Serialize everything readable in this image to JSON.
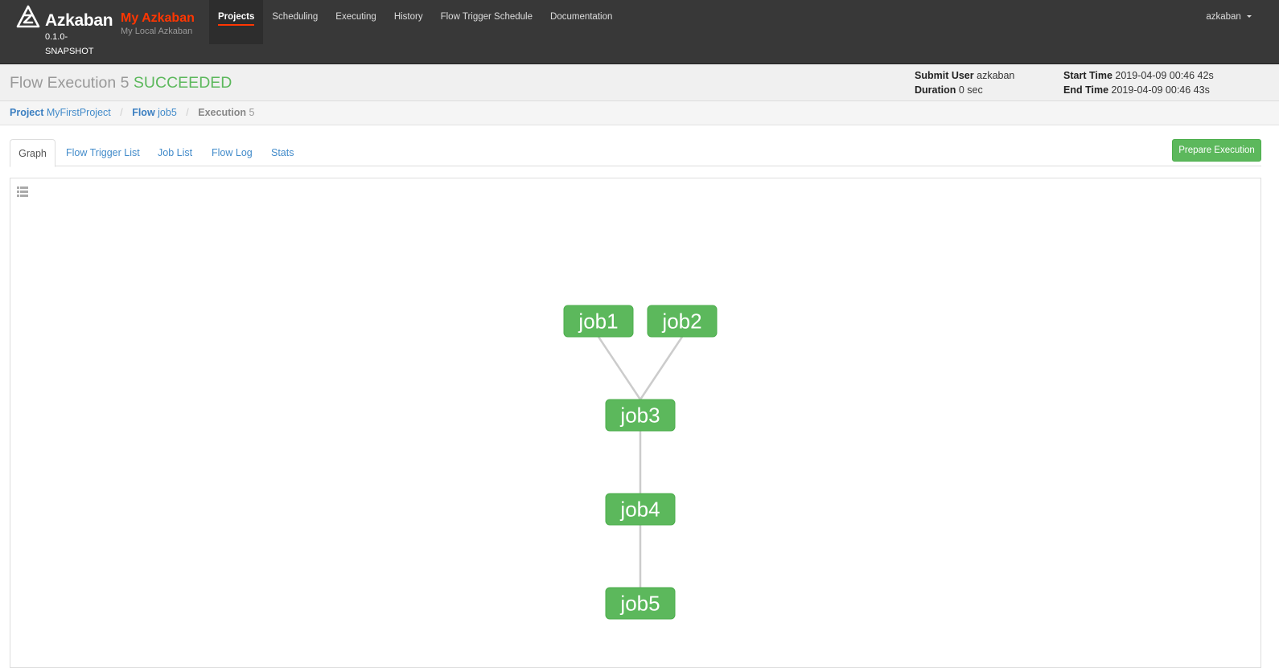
{
  "navbar": {
    "brand_name": "Azkaban",
    "brand_version": "0.1.0-SNAPSHOT",
    "env_name": "My Azkaban",
    "env_description": "My Local Azkaban",
    "nav_items": [
      {
        "label": "Projects",
        "active": true
      },
      {
        "label": "Scheduling",
        "active": false
      },
      {
        "label": "Executing",
        "active": false
      },
      {
        "label": "History",
        "active": false
      },
      {
        "label": "Flow Trigger Schedule",
        "active": false
      },
      {
        "label": "Documentation",
        "active": false
      }
    ],
    "user": "azkaban"
  },
  "header": {
    "title_prefix": "Flow Execution 5",
    "status": "SUCCEEDED",
    "submit_user_label": "Submit User",
    "submit_user": "azkaban",
    "duration_label": "Duration",
    "duration": "0 sec",
    "start_time_label": "Start Time",
    "start_time": "2019-04-09 00:46 42s",
    "end_time_label": "End Time",
    "end_time": "2019-04-09 00:46 43s"
  },
  "breadcrumb": {
    "project_label": "Project",
    "project": "MyFirstProject",
    "flow_label": "Flow",
    "flow": "job5",
    "execution_label": "Execution",
    "execution": "5"
  },
  "tabs": [
    "Graph",
    "Flow Trigger List",
    "Job List",
    "Flow Log",
    "Stats"
  ],
  "actions": {
    "prepare_execution": "Prepare Execution"
  },
  "graph": {
    "nodes": [
      {
        "id": "job1",
        "label": "job1",
        "status": "SUCCEEDED"
      },
      {
        "id": "job2",
        "label": "job2",
        "status": "SUCCEEDED"
      },
      {
        "id": "job3",
        "label": "job3",
        "status": "SUCCEEDED"
      },
      {
        "id": "job4",
        "label": "job4",
        "status": "SUCCEEDED"
      },
      {
        "id": "job5",
        "label": "job5",
        "status": "SUCCEEDED"
      }
    ],
    "edges": [
      {
        "from": "job1",
        "to": "job3"
      },
      {
        "from": "job2",
        "to": "job3"
      },
      {
        "from": "job3",
        "to": "job4"
      },
      {
        "from": "job4",
        "to": "job5"
      }
    ],
    "colors": {
      "succeeded": "#5cb85c",
      "edge": "#cccccc"
    }
  }
}
